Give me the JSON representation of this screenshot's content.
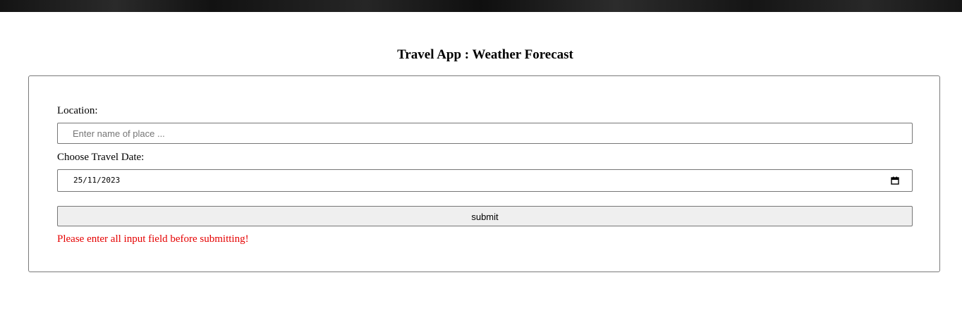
{
  "app": {
    "title": "Travel App : Weather Forecast"
  },
  "form": {
    "location_label": "Location:",
    "location_placeholder": "Enter name of place ...",
    "location_value": "",
    "date_label": "Choose Travel Date:",
    "date_value": "25/11/2023",
    "submit_label": "submit",
    "error_message": "Please enter all input field before submitting!"
  },
  "icons": {
    "date_picker": "calendar-icon"
  },
  "colors": {
    "error": "#e50000",
    "button_background": "#efefef",
    "banner": "#1a1a1a"
  }
}
